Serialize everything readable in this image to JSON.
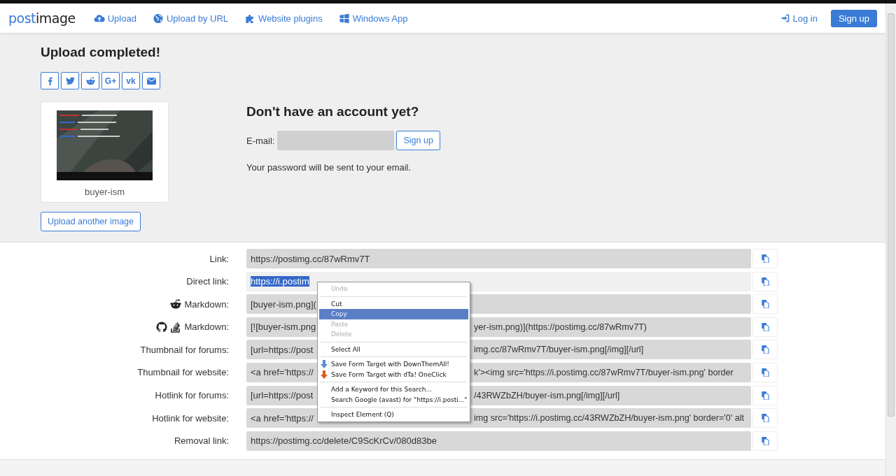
{
  "logo": {
    "part_1": "post",
    "part_2": "image"
  },
  "nav": [
    {
      "kind": "upload",
      "label": "Upload"
    },
    {
      "kind": "url",
      "label": "Upload by URL"
    },
    {
      "kind": "plugins",
      "label": "Website plugins"
    },
    {
      "kind": "windows",
      "label": "Windows App"
    }
  ],
  "login": {
    "label": "Log in"
  },
  "signup_top": {
    "label": "Sign up"
  },
  "heading": "Upload completed!",
  "share_buttons": [
    {
      "kind": "facebook"
    },
    {
      "kind": "twitter"
    },
    {
      "kind": "reddit"
    },
    {
      "kind": "text",
      "glyph": "G+"
    },
    {
      "kind": "text",
      "glyph": "vk"
    },
    {
      "kind": "email"
    }
  ],
  "thumbnail": {
    "kind": "picture",
    "caption": "buyer-ism"
  },
  "upload_another": "Upload another image",
  "account": {
    "title": "Don't have an account yet?",
    "email_label": "E-mail:",
    "signup": "Sign up",
    "note": "Your password will be sent to your email."
  },
  "fields": [
    {
      "kind": "plain",
      "label": "Link:",
      "head": "https://postimg.cc/87wRmv7T",
      "text_selected": false
    },
    {
      "kind": "plain",
      "label": "Direct link:",
      "head": "https://i.postim",
      "text_selected": true
    },
    {
      "kind": "reddit",
      "label": "Markdown:",
      "head": "[buyer-ism.png](",
      "text_selected": false
    },
    {
      "kind": "github",
      "label": "Markdown:",
      "head": "[![buyer-ism.png",
      "tail": "yer-ism.png)](https://postimg.cc/87wRmv7T)",
      "text_selected": false
    },
    {
      "kind": "plain",
      "label": "Thumbnail for forums:",
      "head": "[url=https://post",
      "tail": "img.cc/87wRmv7T/buyer-ism.png[/img][/url]",
      "text_selected": false
    },
    {
      "kind": "plain",
      "label": "Thumbnail for website:",
      "head": "<a href='https://",
      "tail": "k'><img src='https://i.postimg.cc/87wRmv7T/buyer-ism.png' border",
      "text_selected": false
    },
    {
      "kind": "plain",
      "label": "Hotlink for forums:",
      "head": "[url=https://post",
      "tail": "/43RWZbZH/buyer-ism.png[/img][/url]",
      "text_selected": false
    },
    {
      "kind": "plain",
      "label": "Hotlink for website:",
      "head": "<a href='https://",
      "tail": "img src='https://i.postimg.cc/43RWZbZH/buyer-ism.png' border='0' alt",
      "text_selected": false
    },
    {
      "kind": "plain",
      "label": "Removal link:",
      "head": "https://postimg.cc/delete/C9ScKrCv/080d83be",
      "text_selected": false
    }
  ],
  "context_menu": [
    {
      "kind": "item",
      "label": "Undo",
      "disabled": true,
      "selected": false,
      "separator_before": false
    },
    {
      "kind": "item",
      "label": "Cut",
      "disabled": false,
      "selected": false,
      "separator_before": true
    },
    {
      "kind": "item",
      "label": "Copy",
      "disabled": false,
      "selected": true,
      "separator_before": false
    },
    {
      "kind": "item",
      "label": "Paste",
      "disabled": true,
      "selected": false,
      "separator_before": false
    },
    {
      "kind": "item",
      "label": "Delete",
      "disabled": true,
      "selected": false,
      "separator_before": false
    },
    {
      "kind": "item",
      "label": "Select All",
      "disabled": false,
      "selected": false,
      "separator_before": true
    },
    {
      "kind": "downthemall",
      "label": "Save Form Target with DownThemAll!",
      "disabled": false,
      "selected": false,
      "separator_before": true
    },
    {
      "kind": "oneclick",
      "label": "Save Form Target with dTa! OneClick",
      "disabled": false,
      "selected": false,
      "separator_before": false
    },
    {
      "kind": "item",
      "label": "Add a Keyword for this Search...",
      "disabled": false,
      "selected": false,
      "separator_before": true
    },
    {
      "kind": "item",
      "label": "Search Google (avast) for \"https://i.posti...\"",
      "disabled": false,
      "selected": false,
      "separator_before": false
    },
    {
      "kind": "item",
      "label": "Inspect Element (Q)",
      "disabled": false,
      "selected": false,
      "separator_before": true
    }
  ]
}
